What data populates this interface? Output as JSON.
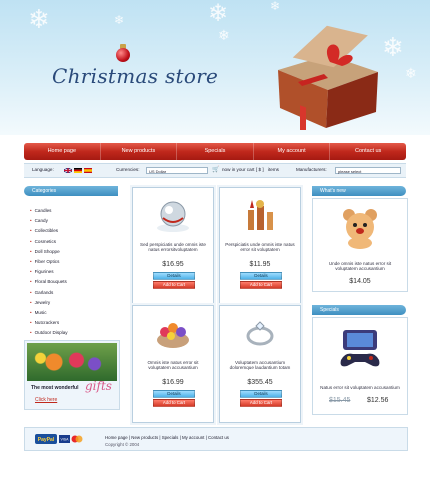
{
  "header": {
    "logo": "Christmas store"
  },
  "menu": [
    "Home page",
    "New products",
    "Specials",
    "My account",
    "Contact us"
  ],
  "options": {
    "language_label": "Language:",
    "currencies_label": "Currencies:",
    "currency_value": "US Dollar",
    "cart_label": "now in your cart",
    "cart_value": "[ $ ]",
    "cart_items": "items",
    "manufacturers_label": "Manufacturers:",
    "manufacturers_value": "please select"
  },
  "categories": {
    "title": "Categories",
    "items": [
      "Candles",
      "Candy",
      "Collectibles",
      "Cosmetics",
      "Doll Shoppe",
      "Fiber Optics",
      "Figurines",
      "Floral Bouquets",
      "Garlands",
      "Jewelry",
      "Music",
      "Nutcrackers",
      "Outdoor Display"
    ]
  },
  "promo": {
    "text": "The most wonderful",
    "script": "gifts",
    "link": "Click here"
  },
  "products": [
    {
      "desc": "Sed perspiciatis unde omnis iste natus errorsitvoluptatem",
      "price": "$16.95",
      "details": "Details",
      "add": "Add to Cart"
    },
    {
      "desc": "Perspiciatis unde omnis iste natus error sit voluptatem",
      "price": "$11.95",
      "details": "Details",
      "add": "Add to Cart"
    },
    {
      "desc": "Omnis iste natus error sit voluptatem accusantium",
      "price": "$16.99",
      "details": "Details",
      "add": "Add to Cart"
    },
    {
      "desc": "Voluptatem accusantium doloremque laudantium totam",
      "price": "$355.45",
      "details": "Details",
      "add": "Add to Cart"
    }
  ],
  "whats_new": {
    "title": "What's new",
    "desc": "Unde omnis iste natus error sit voluptatem accusantium",
    "price": "$14.05"
  },
  "specials": {
    "title": "Specials",
    "desc": "Natus error sit voluptatem accusantium",
    "old_price": "$15.45",
    "new_price": "$12.56"
  },
  "footer": {
    "links": [
      "Home page",
      "New products",
      "Specials",
      "My account",
      "Contact us"
    ],
    "copyright": "Copyright © 2004"
  },
  "colors": {
    "menu_red": "#c0281c",
    "panel_blue": "#3e8fc0",
    "bg_sky": "#bfe2f3"
  }
}
